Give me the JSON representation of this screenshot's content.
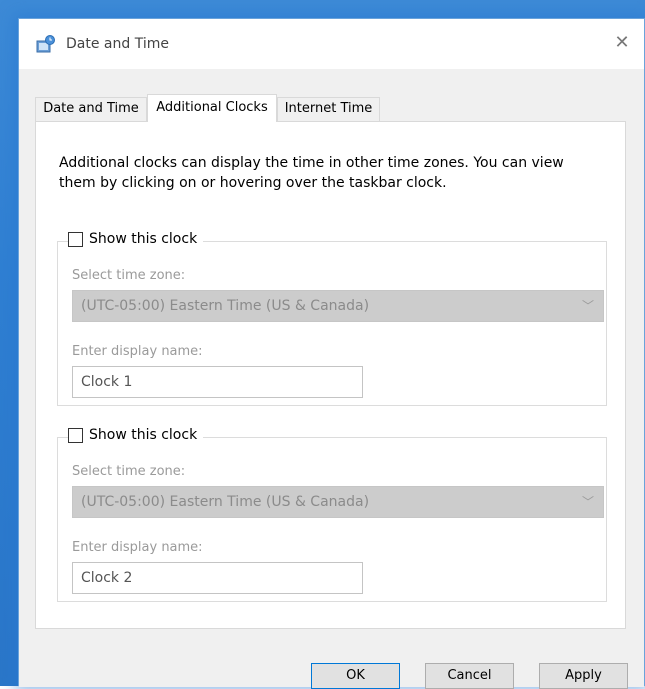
{
  "window": {
    "title": "Date and Time",
    "close_glyph": "✕"
  },
  "tabs": [
    {
      "label": "Date and Time",
      "active": false
    },
    {
      "label": "Additional Clocks",
      "active": true
    },
    {
      "label": "Internet Time",
      "active": false
    }
  ],
  "intro_text": "Additional clocks can display the time in other time zones. You can view them by clicking on or hovering over the taskbar clock.",
  "clocks": [
    {
      "show_label": "Show this clock",
      "checked": false,
      "timezone_label": "Select time zone:",
      "timezone_value": "(UTC-05:00) Eastern Time (US & Canada)",
      "display_name_label": "Enter display name:",
      "display_name_value": "Clock 1"
    },
    {
      "show_label": "Show this clock",
      "checked": false,
      "timezone_label": "Select time zone:",
      "timezone_value": "(UTC-05:00) Eastern Time (US & Canada)",
      "display_name_label": "Enter display name:",
      "display_name_value": "Clock 2"
    }
  ],
  "buttons": {
    "ok": "OK",
    "cancel": "Cancel",
    "apply": "Apply"
  },
  "icons": {
    "title": "clock-globe-icon",
    "dropdown": "chevron-down-icon"
  }
}
